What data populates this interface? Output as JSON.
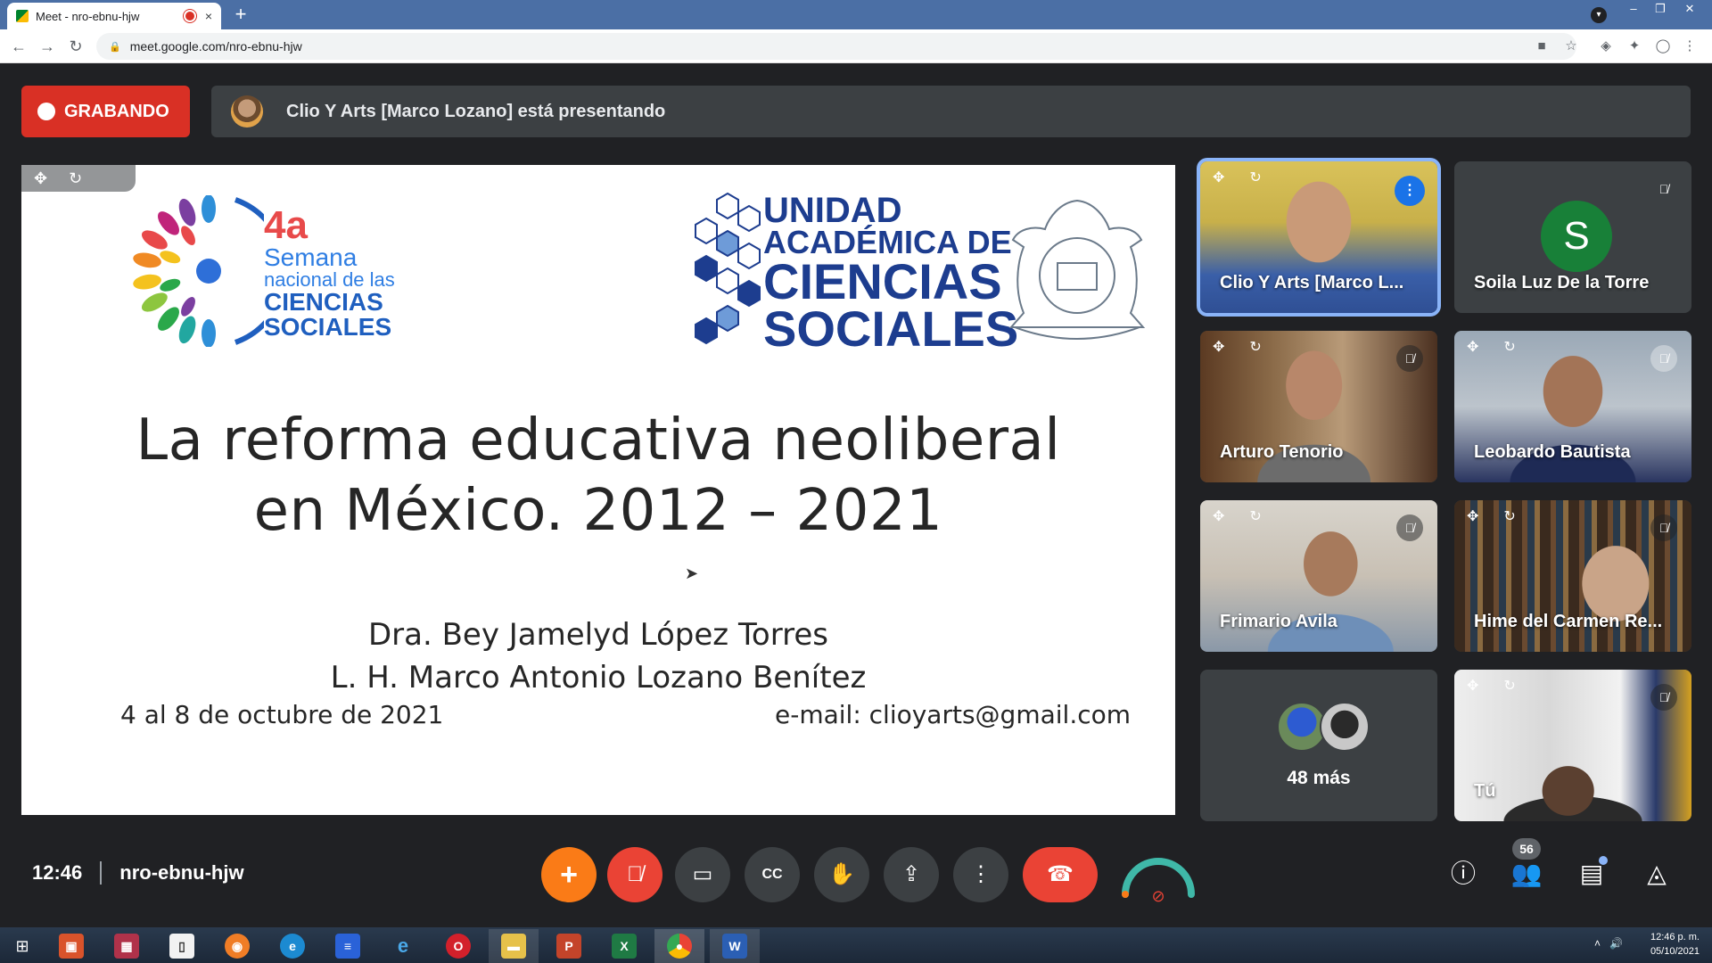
{
  "browser": {
    "tab_title": "Meet - nro-ebnu-hjw",
    "tab_close": "×",
    "new_tab": "+",
    "url": "meet.google.com/nro-ebnu-hjw"
  },
  "meet": {
    "recording_label": "GRABANDO",
    "presenter_text": "Clio Y Arts [Marco Lozano] está presentando",
    "time": "12:46",
    "meeting_code": "nro-ebnu-hjw",
    "participant_count": "56"
  },
  "slide": {
    "logo_left": {
      "number": "4a",
      "line1": "Semana",
      "line2": "nacional de las",
      "line3": "CIENCIAS",
      "line4": "SOCIALES"
    },
    "logo_right": {
      "line1": "UNIDAD",
      "line2": "ACADÉMICA DE",
      "line3": "CIENCIAS",
      "line4": "SOCIALES"
    },
    "title_line1": "La reforma educativa neoliberal",
    "title_line2": "en México. 2012 – 2021",
    "author1": "Dra. Bey Jamelyd López Torres",
    "author2": "L. H. Marco Antonio Lozano Benítez",
    "date": "4 al 8 de octubre de 2021",
    "email": "e-mail: clioyarts@gmail.com"
  },
  "participants": [
    {
      "name": "Clio Y Arts [Marco L...",
      "speaking": true
    },
    {
      "name": "Soila Luz De la Torre",
      "initial": "S",
      "muted": true
    },
    {
      "name": "Arturo Tenorio",
      "muted": true
    },
    {
      "name": "Leobardo Bautista",
      "muted": true
    },
    {
      "name": "Frimario Avila",
      "muted": true
    },
    {
      "name": "Hime del Carmen Re...",
      "muted": true
    },
    {
      "name": "48 más"
    },
    {
      "name": "Tú",
      "muted": true
    }
  ],
  "taskbar": {
    "time": "12:46 p. m.",
    "date": "05/10/2021"
  },
  "colors": {
    "recording_red": "#d93025",
    "meet_bg": "#202124",
    "tile_bg": "#3c4043",
    "active_border": "#8ab4f8",
    "hangup_red": "#ea4335",
    "add_orange": "#fa7b17"
  }
}
